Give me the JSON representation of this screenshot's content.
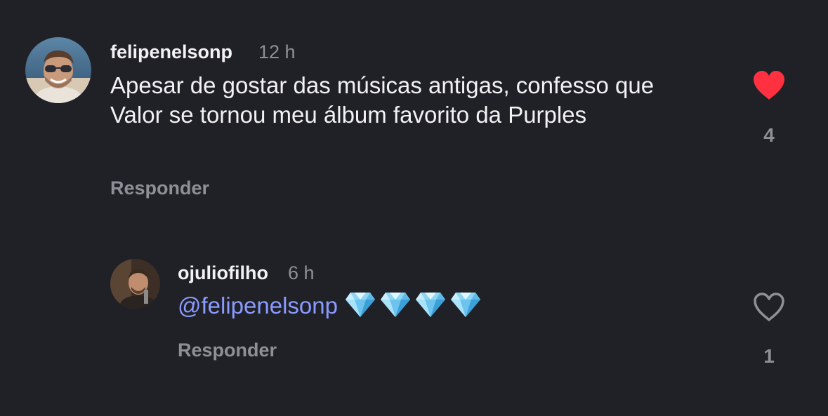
{
  "colors": {
    "background": "#202126",
    "text": "#f2f2f4",
    "muted": "#8e9097",
    "liked": "#ff3040",
    "mention": "#8a9bff"
  },
  "comments": [
    {
      "username": "felipenelsonp",
      "time": "12 h",
      "text": "Apesar de gostar das músicas antigas, confesso que Valor se tornou meu álbum favorito da Purples",
      "reply_label": "Responder",
      "likes": "4",
      "liked": true,
      "avatar_icon": "profile-photo"
    },
    {
      "username": "ojuliofilho",
      "time": "6 h",
      "mention": "@felipenelsonp",
      "emoji": "💎💎💎💎",
      "reply_label": "Responder",
      "likes": "1",
      "liked": false,
      "avatar_icon": "profile-photo"
    }
  ],
  "icons": {
    "like_filled": "heart-filled-icon",
    "like_outline": "heart-outline-icon",
    "emoji": "gem-icon"
  }
}
